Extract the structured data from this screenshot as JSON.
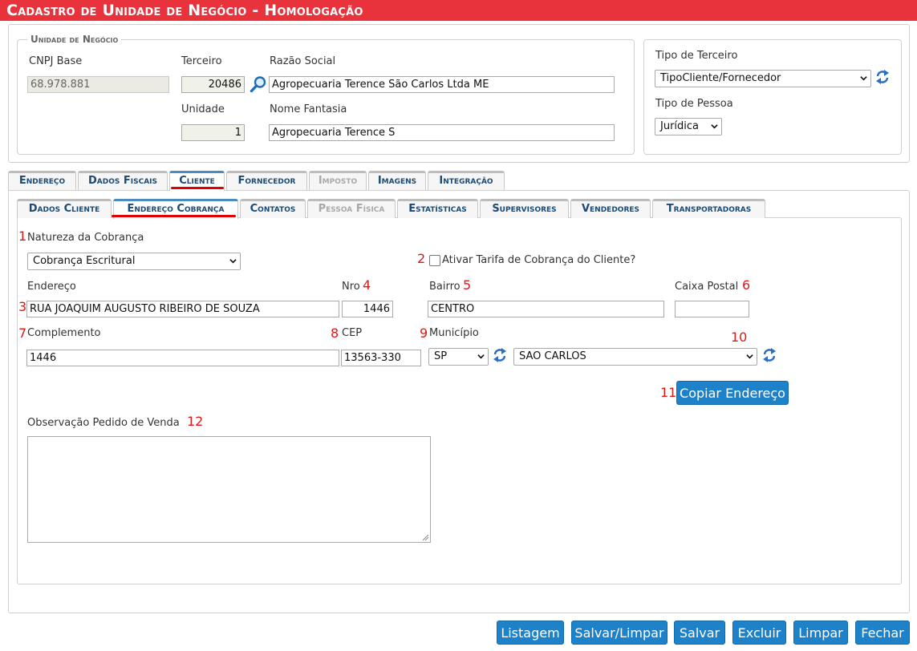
{
  "header": {
    "title": "Cadastro de Unidade de Negócio  - Homologação"
  },
  "unidade": {
    "legend": "Unidade de Negócio",
    "cnpj_label": "CNPJ Base",
    "cnpj_value": "68.978.881",
    "terceiro_label": "Terceiro",
    "terceiro_value": "20486",
    "razao_label": "Razão Social",
    "razao_value": "Agropecuaria Terence São Carlos Ltda ME",
    "unidade_label": "Unidade",
    "unidade_value": "1",
    "fantasia_label": "Nome Fantasia",
    "fantasia_value": "Agropecuaria Terence S"
  },
  "tipos": {
    "terceiro_label": "Tipo de Terceiro",
    "terceiro_value": "TipoCliente/Fornecedor",
    "pessoa_label": "Tipo de Pessoa",
    "pessoa_value": "Jurídica"
  },
  "main_tabs": [
    {
      "label": "Endereço"
    },
    {
      "label": "Dados Fiscais"
    },
    {
      "label": "Cliente"
    },
    {
      "label": "Fornecedor"
    },
    {
      "label": "Imposto"
    },
    {
      "label": "Imagens"
    },
    {
      "label": "Integração"
    }
  ],
  "sub_tabs": [
    {
      "label": "Dados Cliente"
    },
    {
      "label": "Endereço Cobrança"
    },
    {
      "label": "Contatos"
    },
    {
      "label": "Pessoa Física"
    },
    {
      "label": "Estatísticas"
    },
    {
      "label": "Supervisores"
    },
    {
      "label": "Vendedores"
    },
    {
      "label": "Transportadoras"
    }
  ],
  "form": {
    "natureza_label": "Natureza da Cobrança",
    "natureza_value": "Cobrança Escritural",
    "tarifa_label": "Ativar Tarifa de Cobrança do Cliente?",
    "tarifa_checked": false,
    "endereco_label": "Endereço",
    "endereco_value": "RUA JOAQUIM AUGUSTO RIBEIRO DE SOUZA",
    "nro_label": "Nro",
    "nro_value": "1446",
    "bairro_label": "Bairro",
    "bairro_value": "CENTRO",
    "caixa_label": "Caixa Postal",
    "caixa_value": "",
    "complemento_label": "Complemento",
    "complemento_value": "1446",
    "cep_label": "CEP",
    "cep_value": "13563-330",
    "municipio_label": "Município",
    "uf_value": "SP",
    "municipio_value": "SAO CARLOS",
    "copiar_label": "Copiar Endereço",
    "obs_label": "Observação Pedido de Venda",
    "obs_value": ""
  },
  "annotations": [
    "1",
    "2",
    "3",
    "4",
    "5",
    "6",
    "7",
    "8",
    "9",
    "10",
    "11",
    "12"
  ],
  "footer": {
    "listagem": "Listagem",
    "salvar_limpar": "Salvar/Limpar",
    "salvar": "Salvar",
    "excluir": "Excluir",
    "limpar": "Limpar",
    "fechar": "Fechar"
  },
  "colors": {
    "header_bg": "#e8323c",
    "button_bg": "#1d82c9",
    "tab_text": "#1a4a75",
    "annotation_red": "#e01818"
  },
  "icons": {
    "search": "magnifier-icon",
    "refresh": "refresh-icon",
    "dropdown": "chevron-down-icon"
  }
}
